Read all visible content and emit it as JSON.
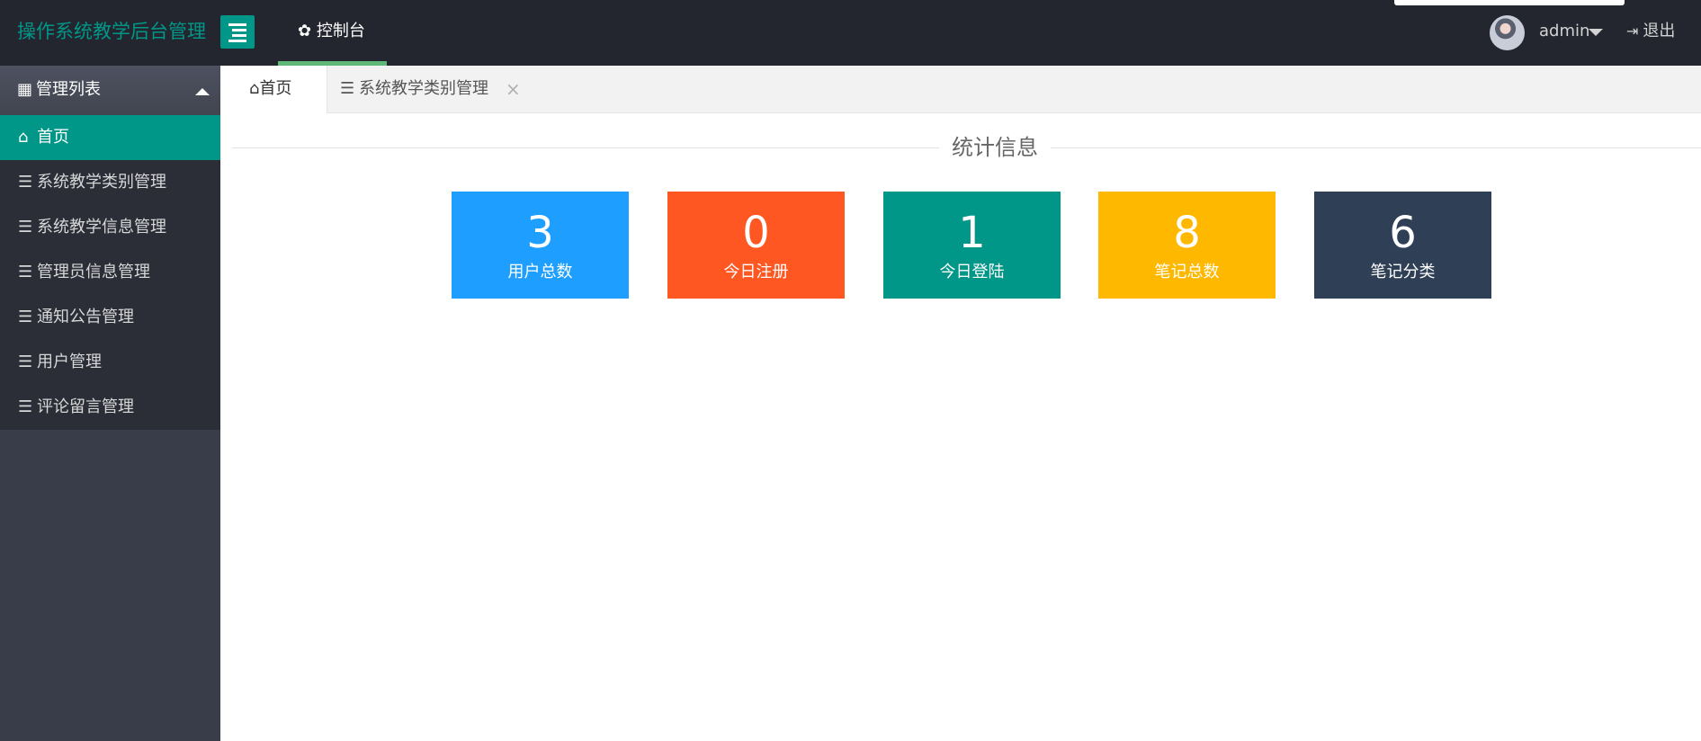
{
  "header": {
    "app_title": "操作系统教学后台管理",
    "console_label": "控制台",
    "user_name": "admin",
    "logout_label": "退出"
  },
  "sidebar": {
    "group_label": "管理列表",
    "items": [
      {
        "label": "首页",
        "active": true
      },
      {
        "label": "系统教学类别管理"
      },
      {
        "label": "系统教学信息管理"
      },
      {
        "label": "管理员信息管理"
      },
      {
        "label": "通知公告管理"
      },
      {
        "label": "用户管理"
      },
      {
        "label": "评论留言管理"
      }
    ]
  },
  "tabs": [
    {
      "label": "首页",
      "active": true
    },
    {
      "label": "系统教学类别管理",
      "closable": true
    }
  ],
  "main": {
    "section_title": "统计信息",
    "stats": [
      {
        "value": "3",
        "label": "用户总数",
        "color": "#1e9fff"
      },
      {
        "value": "0",
        "label": "今日注册",
        "color": "#ff5722"
      },
      {
        "value": "1",
        "label": "今日登陆",
        "color": "#009688"
      },
      {
        "value": "8",
        "label": "笔记总数",
        "color": "#ffb800"
      },
      {
        "value": "6",
        "label": "笔记分类",
        "color": "#2f4056"
      }
    ]
  },
  "icons": {
    "menu_toggle": "menu-fold-icon",
    "console": "gear-icon",
    "user_caret": "caret-down-icon",
    "logout": "sign-out-icon",
    "group": "grid-icon",
    "group_caret": "caret-up-icon",
    "home": "home-icon",
    "list": "list-icon",
    "tab_close": "close-icon"
  }
}
